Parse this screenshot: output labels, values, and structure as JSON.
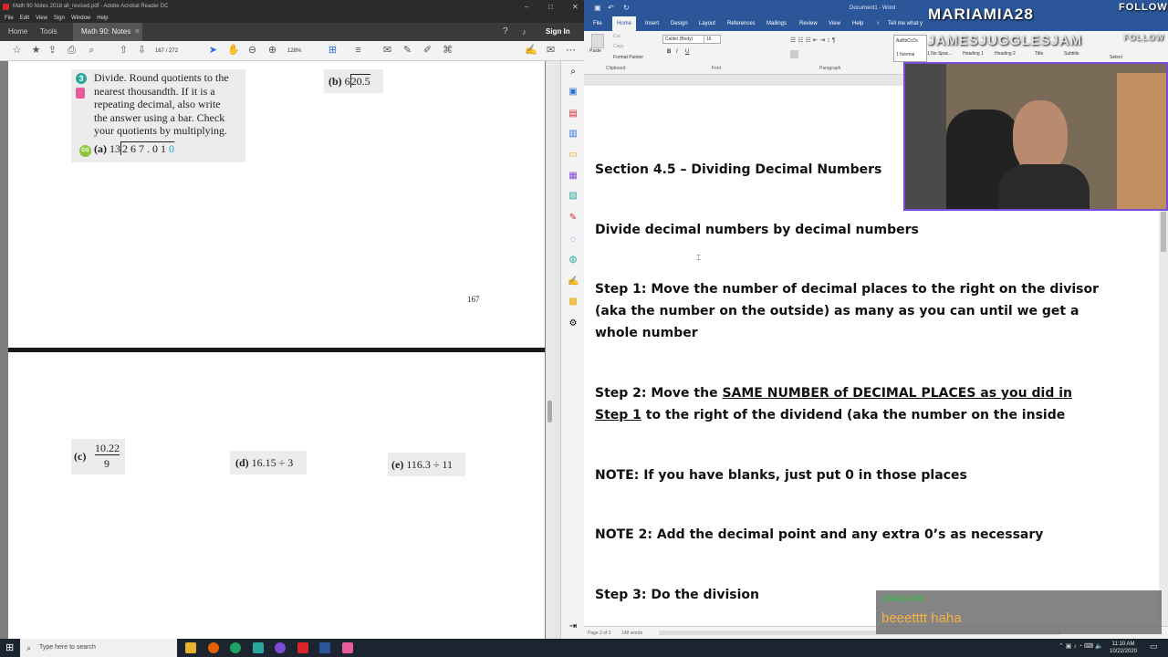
{
  "acrobat": {
    "title": "Math 90 Notes 2018 all_revised.pdf - Adobe Acrobat Reader DC",
    "menu": [
      "File",
      "Edit",
      "View",
      "Sign",
      "Window",
      "Help"
    ],
    "tabs": {
      "home": "Home",
      "tools": "Tools",
      "doc": "Math 90: Notes 20...",
      "signin": "Sign In"
    },
    "page_current": "167",
    "page_total": "/ 272",
    "zoom": "128%",
    "page_number": "167",
    "problem": {
      "number": "3",
      "text": [
        "Divide. Round quotients to the",
        "nearest thousandth. If it is a",
        "repeating decimal, also write",
        "the answer using a bar. Check",
        "your quotients by multiplying."
      ],
      "gs": "GS",
      "a_label": "(a)",
      "a_divisor": "13",
      "a_dividend": "2 6 7 . 0 1",
      "a_zero": "0",
      "b_label": "(b)",
      "b_divisor": "6",
      "b_dividend": "20.5",
      "c_label": "(c)",
      "c_num": "10.22",
      "c_den": "9",
      "d_label": "(d)",
      "d_expr": "16.15 ÷ 3",
      "e_label": "(e)",
      "e_expr": "116.3 ÷ 11"
    }
  },
  "word": {
    "title": "Document1 - Word",
    "tabs": [
      "File",
      "Home",
      "Insert",
      "Design",
      "Layout",
      "References",
      "Mailings",
      "Review",
      "View",
      "Help",
      "Tell me what y"
    ],
    "ribbon": {
      "paste": "Paste",
      "cut": "Cut",
      "copy": "Copy",
      "format_painter": "Format Painter",
      "clipboard": "Clipboard",
      "font_name": "Calibri (Body)",
      "font_size": "16",
      "font_group": "Font",
      "paragraph_group": "Paragraph",
      "styles": [
        "1 Normal",
        "1 No Spac...",
        "Heading 1",
        "Heading 2",
        "Title",
        "Subtitle"
      ],
      "style_sample": "AaBbCcDc",
      "select": "Select"
    },
    "lines": {
      "l1": "Section 4.5 – Dividing Decimal Numbers",
      "l2": "Divide decimal numbers by decimal numbers",
      "l3": "Step 1: Move the number of decimal places to the right on the divisor",
      "l4": "(aka the number on the outside) as many as you can until we get a",
      "l5": "whole number",
      "l6a": "Step 2: Move the ",
      "l6b": "SAME NUMBER of DECIMAL PLACES as you did in",
      "l7a": "Step 1",
      "l7b": " to the right of the dividend (aka the number on the inside",
      "l8": "NOTE: If you have blanks, just put 0 in those places",
      "l9": "NOTE 2: Add the decimal point and any extra 0’s as necessary",
      "l10": "Step 3: Do the division"
    },
    "status": {
      "page": "Page 2 of 2",
      "words": "148 words"
    }
  },
  "overlay": {
    "name1": "MARIAMIA28",
    "follow1": "FOLLOW",
    "name2": "JAMESJUGGLESJAM",
    "follow2": "FOLLOW",
    "chat_user": "CNAZLIAN",
    "chat_msg": "beeetttt haha"
  },
  "taskbar": {
    "search": "Type here to search",
    "time": "11:10 AM",
    "date": "10/22/2020"
  },
  "colors": {
    "accent_word": "#2b579a",
    "problem_teal": "#2aa79b",
    "overlay_border": "#7b4bd8",
    "chat_text": "#f6b23e"
  }
}
